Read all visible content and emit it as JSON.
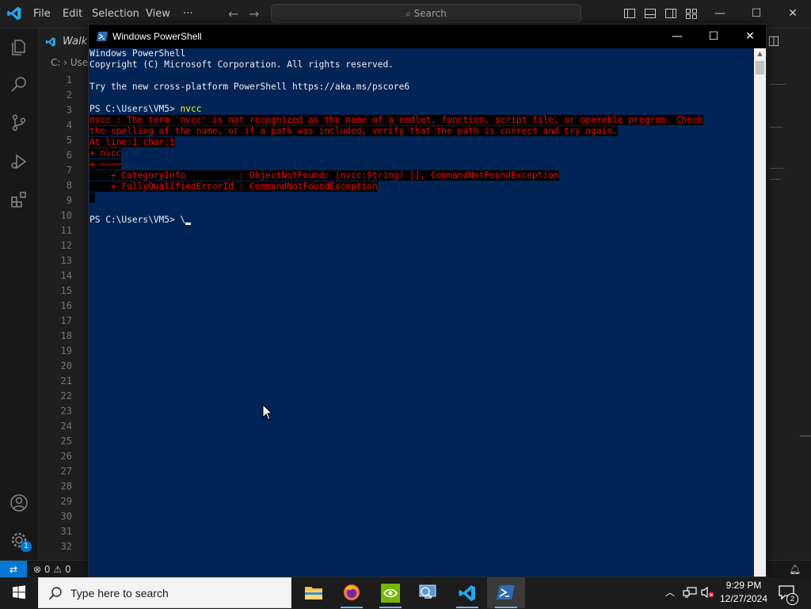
{
  "vscode": {
    "menu": [
      "File",
      "Edit",
      "Selection",
      "View",
      "···"
    ],
    "search_placeholder": "Search",
    "tab_label": "Walk",
    "breadcrumb": "C: › Use",
    "line_numbers": [
      "1",
      "2",
      "3",
      "4",
      "5",
      "6",
      "7",
      "8",
      "9",
      "10",
      "11",
      "12",
      "13",
      "14",
      "15",
      "16",
      "17",
      "18",
      "19",
      "20",
      "21",
      "22",
      "23",
      "24",
      "25",
      "26",
      "27",
      "28",
      "29",
      "30",
      "31",
      "32"
    ],
    "accounts_badge": "1",
    "status": {
      "errors": "0",
      "warnings": "0",
      "notifications_symbol": "⍾"
    },
    "colors": {
      "accent": "#0078d4",
      "background": "#1f1f1f"
    }
  },
  "powershell": {
    "title": "Windows PowerShell",
    "lines": {
      "l1": "Windows PowerShell",
      "l2": "Copyright (C) Microsoft Corporation. All rights reserved.",
      "l3": "",
      "l4": "Try the new cross-platform PowerShell https://aka.ms/pscore6",
      "l5": "",
      "prompt1": "PS C:\\Users\\VM5> ",
      "cmd1": "nvcc",
      "err1": "nvcc : The term 'nvcc' is not recognized as the name of a cmdlet, function, script file, or operable program. Check",
      "err2": "the spelling of the name, or if a path was included, verify that the path is correct and try again.",
      "err3": "At line:1 char:1",
      "err4": "+ nvcc",
      "err5": "+ ~~~~",
      "err6": "    + CategoryInfo          : ObjectNotFound: (nvcc:String) [], CommandNotFoundException",
      "err7": "    + FullyQualifiedErrorId : CommandNotFoundException",
      "err8": " ",
      "prompt2": "PS C:\\Users\\VM5> ",
      "cmd2": "\\"
    },
    "colors": {
      "background": "#012456",
      "error_fg": "#ff0000",
      "command_fg": "#ffff00"
    }
  },
  "taskbar": {
    "search_placeholder": "Type here to search",
    "time": "9:29 PM",
    "date": "12/27/2024",
    "notification_count": "2",
    "apps": [
      "file-explorer-icon",
      "firefox-icon",
      "nvidia-icon",
      "remote-desktop-icon",
      "vscode-icon",
      "powershell-icon"
    ]
  }
}
